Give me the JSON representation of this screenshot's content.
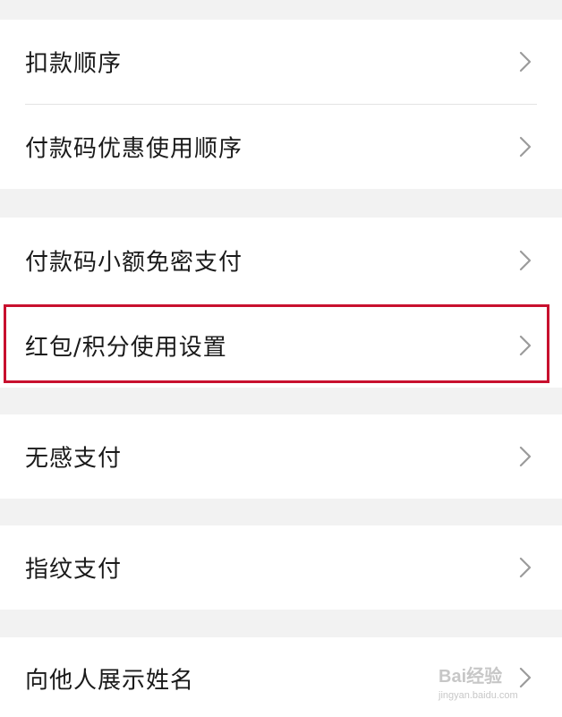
{
  "colors": {
    "background": "#f2f2f2",
    "row_background": "#ffffff",
    "text": "#1a1a1a",
    "chevron": "#9b9b9b",
    "highlight_border": "#c8102e"
  },
  "settings": {
    "items": [
      {
        "label": "扣款顺序",
        "icon": "chevron-right-icon"
      },
      {
        "label": "付款码优惠使用顺序",
        "icon": "chevron-right-icon"
      },
      {
        "label": "付款码小额免密支付",
        "icon": "chevron-right-icon"
      },
      {
        "label": "红包/积分使用设置",
        "icon": "chevron-right-icon",
        "highlighted": true
      },
      {
        "label": "无感支付",
        "icon": "chevron-right-icon"
      },
      {
        "label": "指纹支付",
        "icon": "chevron-right-icon"
      },
      {
        "label": "向他人展示姓名",
        "icon": "chevron-right-icon"
      }
    ]
  },
  "watermark": {
    "brand": "Bai经验",
    "url": "jingyan.baidu.com"
  }
}
